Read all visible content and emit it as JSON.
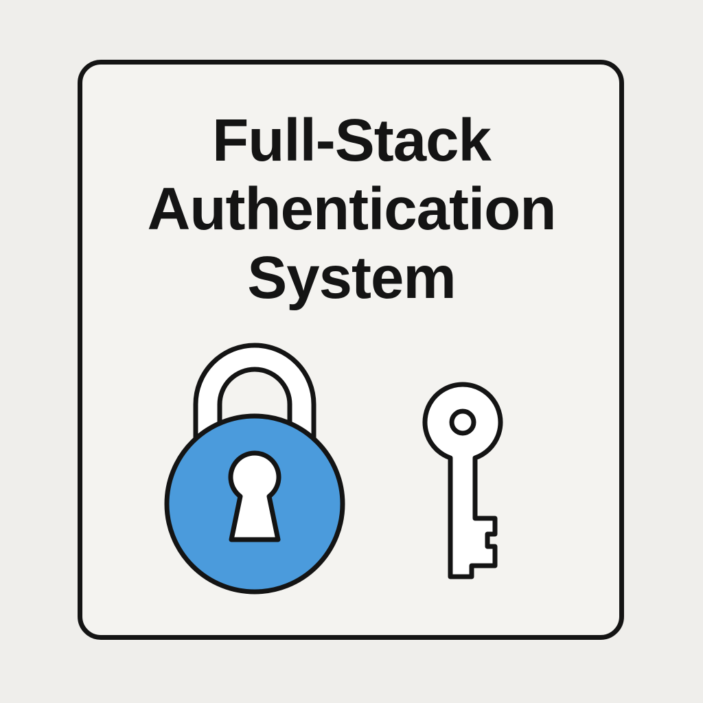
{
  "title": {
    "line1": "Full-Stack",
    "line2": "Authentication",
    "line3": "System"
  },
  "icons": {
    "lock": "padlock-icon",
    "key": "key-icon"
  },
  "colors": {
    "background": "#efeeeb",
    "card": "#f4f3f0",
    "outline": "#141414",
    "lock_body": "#4b9bdc"
  }
}
